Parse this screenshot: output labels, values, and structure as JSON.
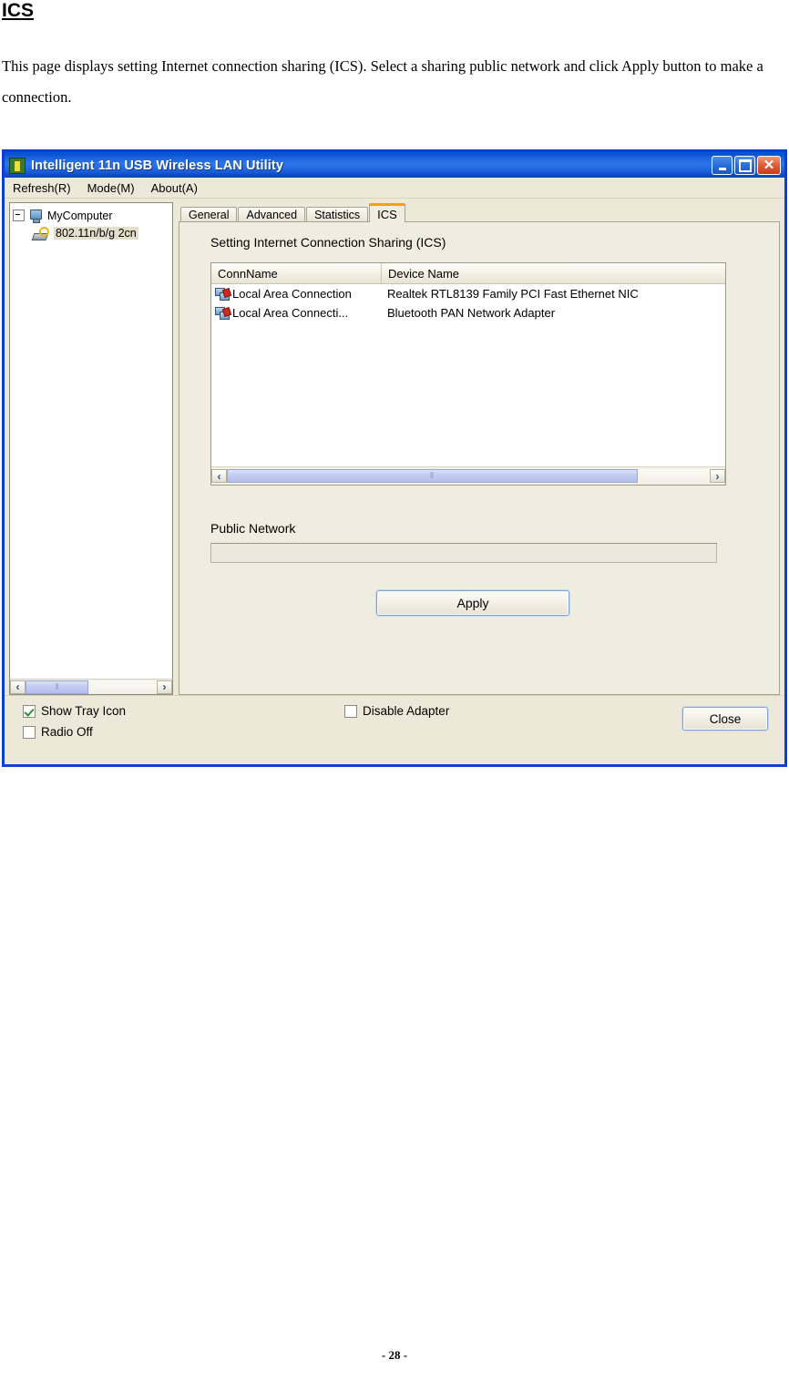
{
  "document": {
    "heading": "ICS",
    "paragraph": "This page displays setting Internet connection sharing (ICS). Select a sharing public network and click Apply button to make a connection.",
    "footer": "- 28 -"
  },
  "window": {
    "title": "Intelligent 11n USB Wireless LAN Utility",
    "icon": "app-shield-icon",
    "controls": {
      "minimize": "_",
      "maximize": "□",
      "close": "✕"
    }
  },
  "menubar": {
    "items": [
      {
        "label": "Refresh(R)"
      },
      {
        "label": "Mode(M)"
      },
      {
        "label": "About(A)"
      }
    ]
  },
  "tree": {
    "root": {
      "label": "MyComputer",
      "icon": "computer-icon"
    },
    "children": [
      {
        "label": "802.11n/b/g 2cn",
        "icon": "wireless-adapter-icon",
        "selected": true
      }
    ],
    "scrollbar": {
      "left_arrow": "‹",
      "right_arrow": "›",
      "grip": "⦀"
    }
  },
  "tabs": [
    {
      "label": "General",
      "active": false
    },
    {
      "label": "Advanced",
      "active": false
    },
    {
      "label": "Statistics",
      "active": false
    },
    {
      "label": "ICS",
      "active": true
    }
  ],
  "ics_panel": {
    "section_title": "Setting Internet Connection Sharing (ICS)",
    "listview": {
      "columns": [
        "ConnName",
        "Device Name"
      ],
      "rows": [
        {
          "conn_name": "Local Area Connection",
          "device_name": "Realtek RTL8139 Family PCI Fast Ethernet NIC",
          "icon": "lan-connection-icon"
        },
        {
          "conn_name": "Local Area Connecti...",
          "device_name": "Bluetooth PAN Network Adapter",
          "icon": "lan-connection-icon"
        }
      ],
      "scrollbar": {
        "left_arrow": "‹",
        "right_arrow": "›",
        "grip": "⦀"
      }
    },
    "public_network": {
      "label": "Public Network",
      "value": "",
      "placeholder": ""
    },
    "apply_button": "Apply"
  },
  "statusbar": {
    "show_tray_icon": {
      "label": "Show Tray Icon",
      "checked": true
    },
    "radio_off": {
      "label": "Radio Off",
      "checked": false
    },
    "disable_adapter": {
      "label": "Disable Adapter",
      "checked": false
    },
    "close_button": "Close"
  },
  "colors": {
    "title_bar_blue": "#0a50d0",
    "window_border": "#0a3fd4",
    "panel_beige": "#ece9d8",
    "tab_page": "#efece0",
    "active_tab_accent": "#f2a11c",
    "scroll_thumb": "#b4c0ec",
    "check_green": "#2f8b2f"
  }
}
